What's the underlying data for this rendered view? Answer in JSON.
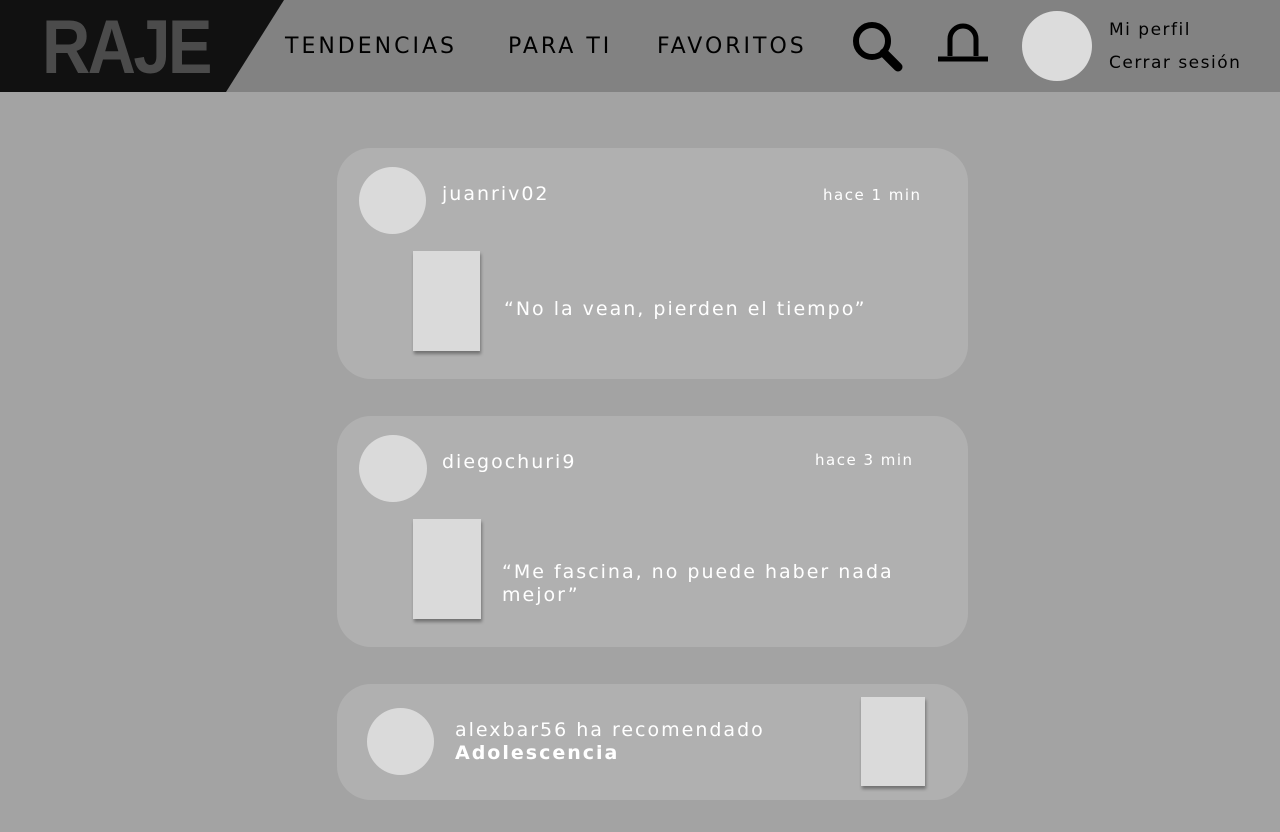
{
  "app": {
    "logo": "RAJE"
  },
  "nav": {
    "tendencias": "TENDENCIAS",
    "para_ti": "PARA TI",
    "favoritos": "FAVORITOS"
  },
  "profile": {
    "mi_perfil": "Mi perfil",
    "cerrar_sesion": "Cerrar sesión"
  },
  "icons": {
    "search": "search-icon",
    "notifications": "bell-icon"
  },
  "feed": [
    {
      "username": "juanriv02",
      "time": "hace 1 min",
      "quote": "“No la vean, pierden el tiempo”"
    },
    {
      "username": "diegochuri9",
      "time": "hace 3 min",
      "quote": "“Me fascina, no puede haber nada mejor”"
    }
  ],
  "recommendation": {
    "text": "alexbar56 ha recomendado",
    "title": "Adolescencia"
  },
  "colors": {
    "header_bg": "#828282",
    "logo_bg": "#111111",
    "page_bg": "#a3a3a3",
    "card_bg": "#b0b0b0",
    "placeholder": "#dadada"
  }
}
